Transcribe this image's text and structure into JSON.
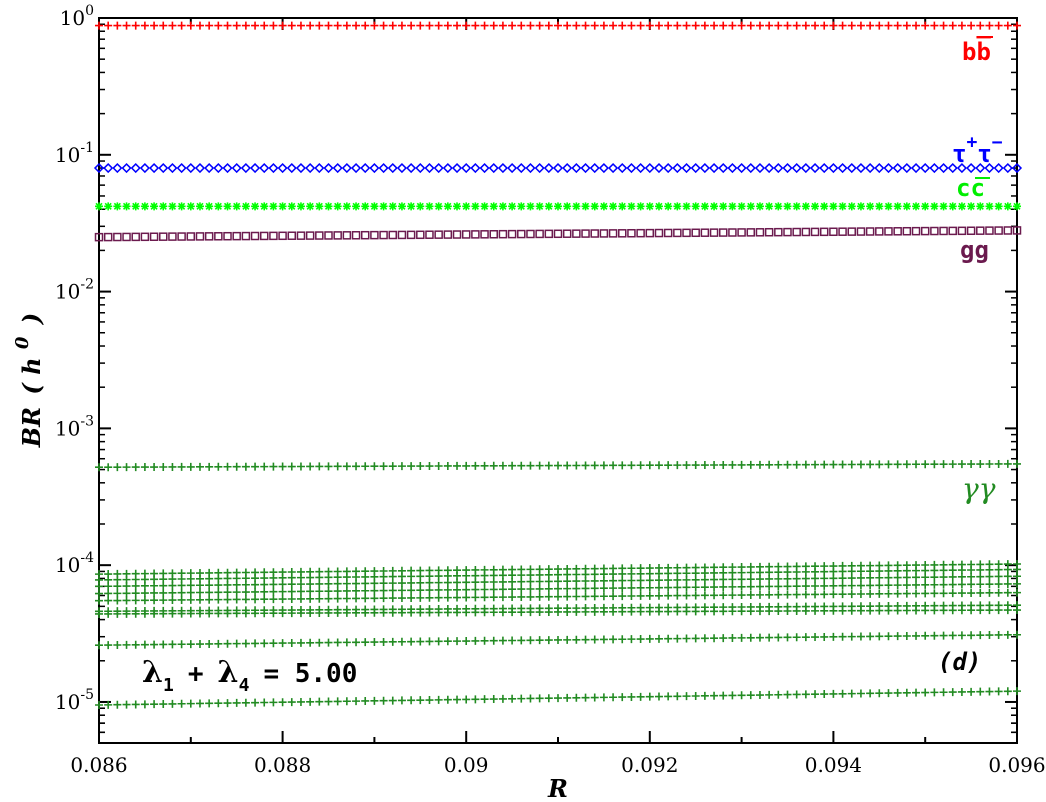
{
  "chart_data": {
    "type": "scatter",
    "xlabel": "R",
    "ylabel_main": "BR",
    "ylabel_paren_open": "(",
    "ylabel_sym": "h",
    "ylabel_sup": "0",
    "ylabel_paren_close": ")",
    "xlim": [
      0.086,
      0.096
    ],
    "ylim_log10": [
      -5.3,
      0.0
    ],
    "y_scale": "log",
    "grid": false,
    "x_ticks": [
      0.086,
      0.088,
      0.09,
      0.092,
      0.094,
      0.096
    ],
    "x_tick_labels": [
      "0.086",
      "0.088",
      "0.09",
      "0.092",
      "0.094",
      "0.096"
    ],
    "y_ticks_exp": [
      0,
      -1,
      -2,
      -3,
      -4,
      -5
    ],
    "y_tick_base": "10",
    "y_tick_exp_labels": [
      "0",
      "-1",
      "-2",
      "-3",
      "-4",
      "-5"
    ],
    "panel_label": "(d)",
    "annotation": {
      "lambda_a": "λ",
      "sub_a": "1",
      "plus": "+",
      "lambda_b": "λ",
      "sub_b": "4",
      "equals_value": "= 5.00"
    },
    "series_labels": {
      "bb_base": "b",
      "bb_bar": "b",
      "tautau_a": "τ",
      "tautau_sup_a": "+",
      "tautau_b": "τ",
      "tautau_sup_b": "−",
      "cc_base": "c",
      "cc_bar": "c",
      "gg": "gg",
      "gammagamma": "γγ"
    },
    "series": [
      {
        "key": "bb",
        "marker": "plus",
        "color": "#ff0000",
        "x_range": [
          0.086,
          0.096
        ],
        "y": [
          0.88,
          0.88
        ]
      },
      {
        "key": "tautau",
        "marker": "diamond",
        "color": "#0000ff",
        "x_range": [
          0.086,
          0.096
        ],
        "y": [
          0.08,
          0.08
        ]
      },
      {
        "key": "cc",
        "marker": "star",
        "color": "#00ff00",
        "x_range": [
          0.086,
          0.096
        ],
        "y": [
          0.042,
          0.042
        ]
      },
      {
        "key": "gg",
        "marker": "square",
        "color": "#6b1a4e",
        "x_range": [
          0.086,
          0.096
        ],
        "y": [
          0.025,
          0.028
        ]
      },
      {
        "key": "gammagamma",
        "marker": "plus",
        "color": "#228b22",
        "x_range": [
          0.086,
          0.096
        ],
        "y": [
          0.00052,
          0.00055
        ]
      },
      {
        "key": "minor1",
        "marker": "plus",
        "color": "#228b22",
        "x_range": [
          0.086,
          0.096
        ],
        "y": [
          8.6e-05,
          0.000102
        ]
      },
      {
        "key": "minor2",
        "marker": "plus",
        "color": "#228b22",
        "x_range": [
          0.086,
          0.096
        ],
        "y": [
          7.8e-05,
          9.3e-05
        ]
      },
      {
        "key": "minor3",
        "marker": "plus",
        "color": "#228b22",
        "x_range": [
          0.086,
          0.096
        ],
        "y": [
          7e-05,
          8.3e-05
        ]
      },
      {
        "key": "minor4",
        "marker": "plus",
        "color": "#228b22",
        "x_range": [
          0.086,
          0.096
        ],
        "y": [
          6.2e-05,
          7.3e-05
        ]
      },
      {
        "key": "minor5",
        "marker": "plus",
        "color": "#228b22",
        "x_range": [
          0.086,
          0.096
        ],
        "y": [
          5.5e-05,
          6.3e-05
        ]
      },
      {
        "key": "minor6",
        "marker": "plus",
        "color": "#228b22",
        "x_range": [
          0.086,
          0.096
        ],
        "y": [
          4.6e-05,
          5.1e-05
        ]
      },
      {
        "key": "minor7",
        "marker": "plus",
        "color": "#228b22",
        "x_range": [
          0.086,
          0.096
        ],
        "y": [
          4.4e-05,
          4.7e-05
        ]
      },
      {
        "key": "minor8",
        "marker": "plus",
        "color": "#228b22",
        "x_range": [
          0.086,
          0.096
        ],
        "y": [
          2.6e-05,
          3.1e-05
        ]
      },
      {
        "key": "minor9",
        "marker": "plus",
        "color": "#228b22",
        "x_range": [
          0.086,
          0.096
        ],
        "y": [
          9.5e-06,
          1.2e-05
        ]
      }
    ],
    "colors": {
      "bb": "#ff0000",
      "tautau": "#0000ff",
      "cc": "#00ff00",
      "gg": "#6b1a4e",
      "gammagamma": "#228b22"
    }
  }
}
